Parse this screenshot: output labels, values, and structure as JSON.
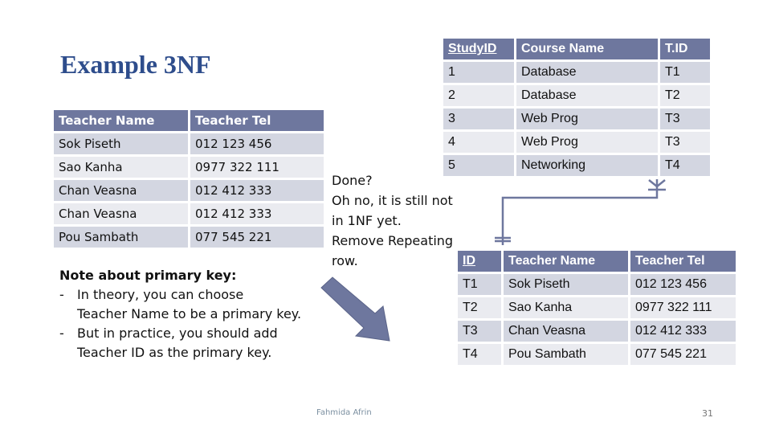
{
  "slide": {
    "title": "Example 3NF",
    "footer": "Fahmida Afrin",
    "page_number": "31"
  },
  "original_table": {
    "headers": [
      "Teacher Name",
      "Teacher Tel"
    ],
    "rows": [
      [
        "Sok Piseth",
        "012 123 456"
      ],
      [
        "Sao Kanha",
        "0977 322 111"
      ],
      [
        "Chan Veasna",
        "012 412 333"
      ],
      [
        "Chan Veasna",
        "012 412 333"
      ],
      [
        "Pou Sambath",
        "077 545 221"
      ]
    ]
  },
  "study_table": {
    "headers": [
      "StudyID",
      "Course Name",
      "T.ID"
    ],
    "primary_key": "StudyID",
    "rows": [
      [
        "1",
        "Database",
        "T1"
      ],
      [
        "2",
        "Database",
        "T2"
      ],
      [
        "3",
        "Web Prog",
        "T3"
      ],
      [
        "4",
        "Web Prog",
        "T3"
      ],
      [
        "5",
        "Networking",
        "T4"
      ]
    ]
  },
  "teacher_table": {
    "headers": [
      "ID",
      "Teacher Name",
      "Teacher Tel"
    ],
    "primary_key": "ID",
    "rows": [
      [
        "T1",
        "Sok Piseth",
        "012 123 456"
      ],
      [
        "T2",
        "Sao Kanha",
        "0977 322 111"
      ],
      [
        "T3",
        "Chan Veasna",
        "012 412 333"
      ],
      [
        "T4",
        "Pou Sambath",
        "077 545 221"
      ]
    ]
  },
  "callout": {
    "lines": [
      "Done?",
      "Oh no, it is still not",
      "in 1NF yet.",
      "Remove Repeating",
      "row."
    ]
  },
  "note": {
    "heading": "Note about primary key:",
    "items": [
      {
        "bullet": "-",
        "lines": [
          "In theory, you can choose",
          "Teacher Name to be a primary key."
        ]
      },
      {
        "bullet": "-",
        "lines": [
          "But in practice, you should add",
          "Teacher ID as the primary key."
        ]
      }
    ]
  },
  "relationship": {
    "type": "one-to-many",
    "from": "teacher_table.ID",
    "to": "study_table.T.ID",
    "color": "#6e779e"
  },
  "arrow": {
    "color": "#6e779e",
    "direction": "down-right"
  }
}
